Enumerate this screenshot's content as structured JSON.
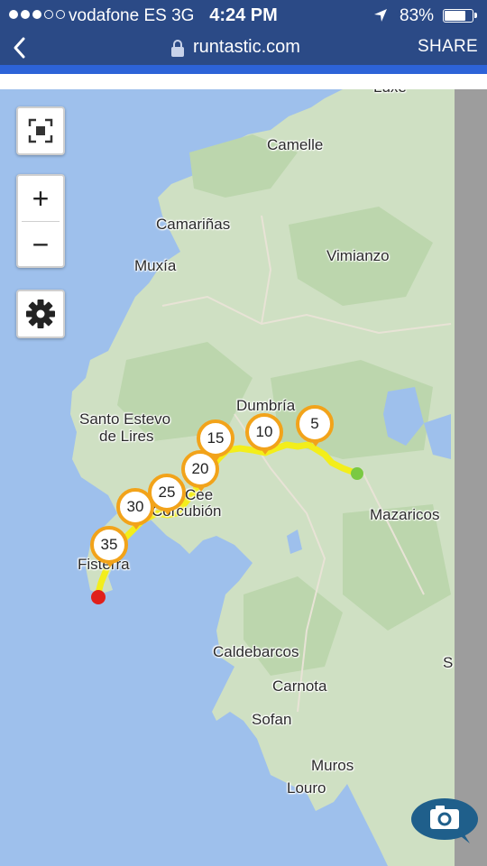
{
  "status_bar": {
    "carrier": "vodafone ES",
    "network": "3G",
    "time": "4:24 PM",
    "battery_percent": "83%",
    "battery_level": 0.83,
    "signal_bars_filled": 3,
    "signal_bars_total": 5
  },
  "url_bar": {
    "domain": "runtastic.com",
    "share_label": "SHARE",
    "back_icon": "chevron-left-icon",
    "lock_icon": "lock-icon"
  },
  "map": {
    "places": [
      {
        "id": "luxe",
        "name": "Luxe"
      },
      {
        "id": "camelle",
        "name": "Camelle"
      },
      {
        "id": "camarinas",
        "name": "Camariñas"
      },
      {
        "id": "vimianzo",
        "name": "Vimianzo"
      },
      {
        "id": "muxia",
        "name": "Muxía"
      },
      {
        "id": "dumbria",
        "name": "Dumbría"
      },
      {
        "id": "santo-estevo-1",
        "name": "Santo Estevo"
      },
      {
        "id": "santo-estevo-2",
        "name": "de Lires"
      },
      {
        "id": "mazaricos",
        "name": "Mazaricos"
      },
      {
        "id": "cee",
        "name": "Cee"
      },
      {
        "id": "corcubion",
        "name": "Corcubión"
      },
      {
        "id": "fisterra",
        "name": "Fisterra"
      },
      {
        "id": "caldebarcos",
        "name": "Caldebarcos"
      },
      {
        "id": "carnota",
        "name": "Carnota"
      },
      {
        "id": "sofan",
        "name": "Sofan"
      },
      {
        "id": "muros",
        "name": "Muros"
      },
      {
        "id": "louro",
        "name": "Louro"
      },
      {
        "id": "s-edge",
        "name": "S"
      }
    ],
    "km_markers": [
      "5",
      "10",
      "15",
      "20",
      "25",
      "30",
      "35"
    ],
    "start_color": "#7ac943",
    "end_color": "#e0201b",
    "route_color": "#f3ee1a",
    "marker_color": "#f2a31a",
    "water_color": "#9ec0ec",
    "land_color": "#cfe0c3"
  },
  "controls": {
    "fullscreen_icon": "fullscreen-icon",
    "zoom_in": "+",
    "zoom_out": "−",
    "settings_icon": "gear-icon",
    "camera_icon": "camera-icon"
  }
}
